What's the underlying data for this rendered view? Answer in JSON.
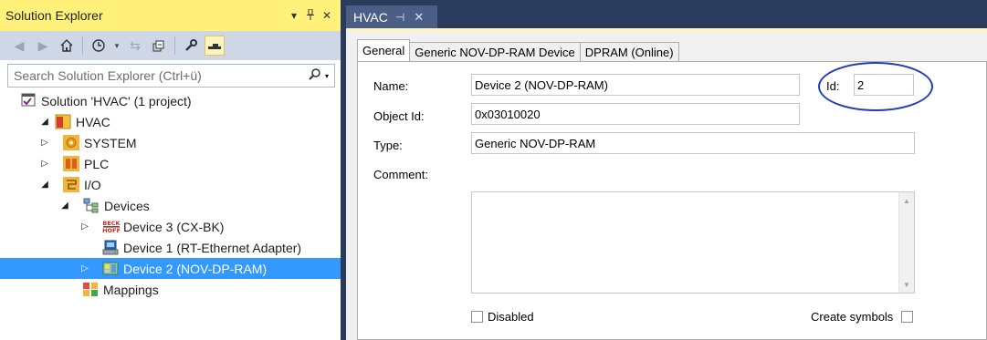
{
  "solution_explorer": {
    "title": "Solution Explorer",
    "title_controls": [
      "▾",
      "📌",
      "✕"
    ],
    "search_placeholder": "Search Solution Explorer (Ctrl+ü)",
    "tree": {
      "solution": "Solution 'HVAC' (1 project)",
      "project": "HVAC",
      "system": "SYSTEM",
      "plc": "PLC",
      "io": "I/O",
      "devices": "Devices",
      "device3": "Device 3 (CX-BK)",
      "device1": "Device 1 (RT-Ethernet Adapter)",
      "device2": "Device 2 (NOV-DP-RAM)",
      "mappings": "Mappings"
    },
    "selected_item": "Device 2 (NOV-DP-RAM)"
  },
  "document_tab": {
    "title": "HVAC",
    "pin_glyph": "⊣",
    "close_glyph": "✕"
  },
  "property_tabs": [
    "General",
    "Generic NOV-DP-RAM Device",
    "DPRAM (Online)"
  ],
  "active_tab": "General",
  "general": {
    "name_label": "Name:",
    "name_value": "Device 2 (NOV-DP-RAM)",
    "id_label": "Id:",
    "id_value": "2",
    "objectid_label": "Object Id:",
    "objectid_value": "0x03010020",
    "type_label": "Type:",
    "type_value": "Generic NOV-DP-RAM",
    "comment_label": "Comment:",
    "comment_value": "",
    "disabled_label": "Disabled",
    "disabled_checked": false,
    "create_symbols_label": "Create symbols",
    "create_symbols_checked": false
  },
  "colors": {
    "active_title": "#fff17a",
    "selection": "#3399ff",
    "ide_background": "#2b3b5c",
    "highlight_oval": "#1f3fb5"
  }
}
